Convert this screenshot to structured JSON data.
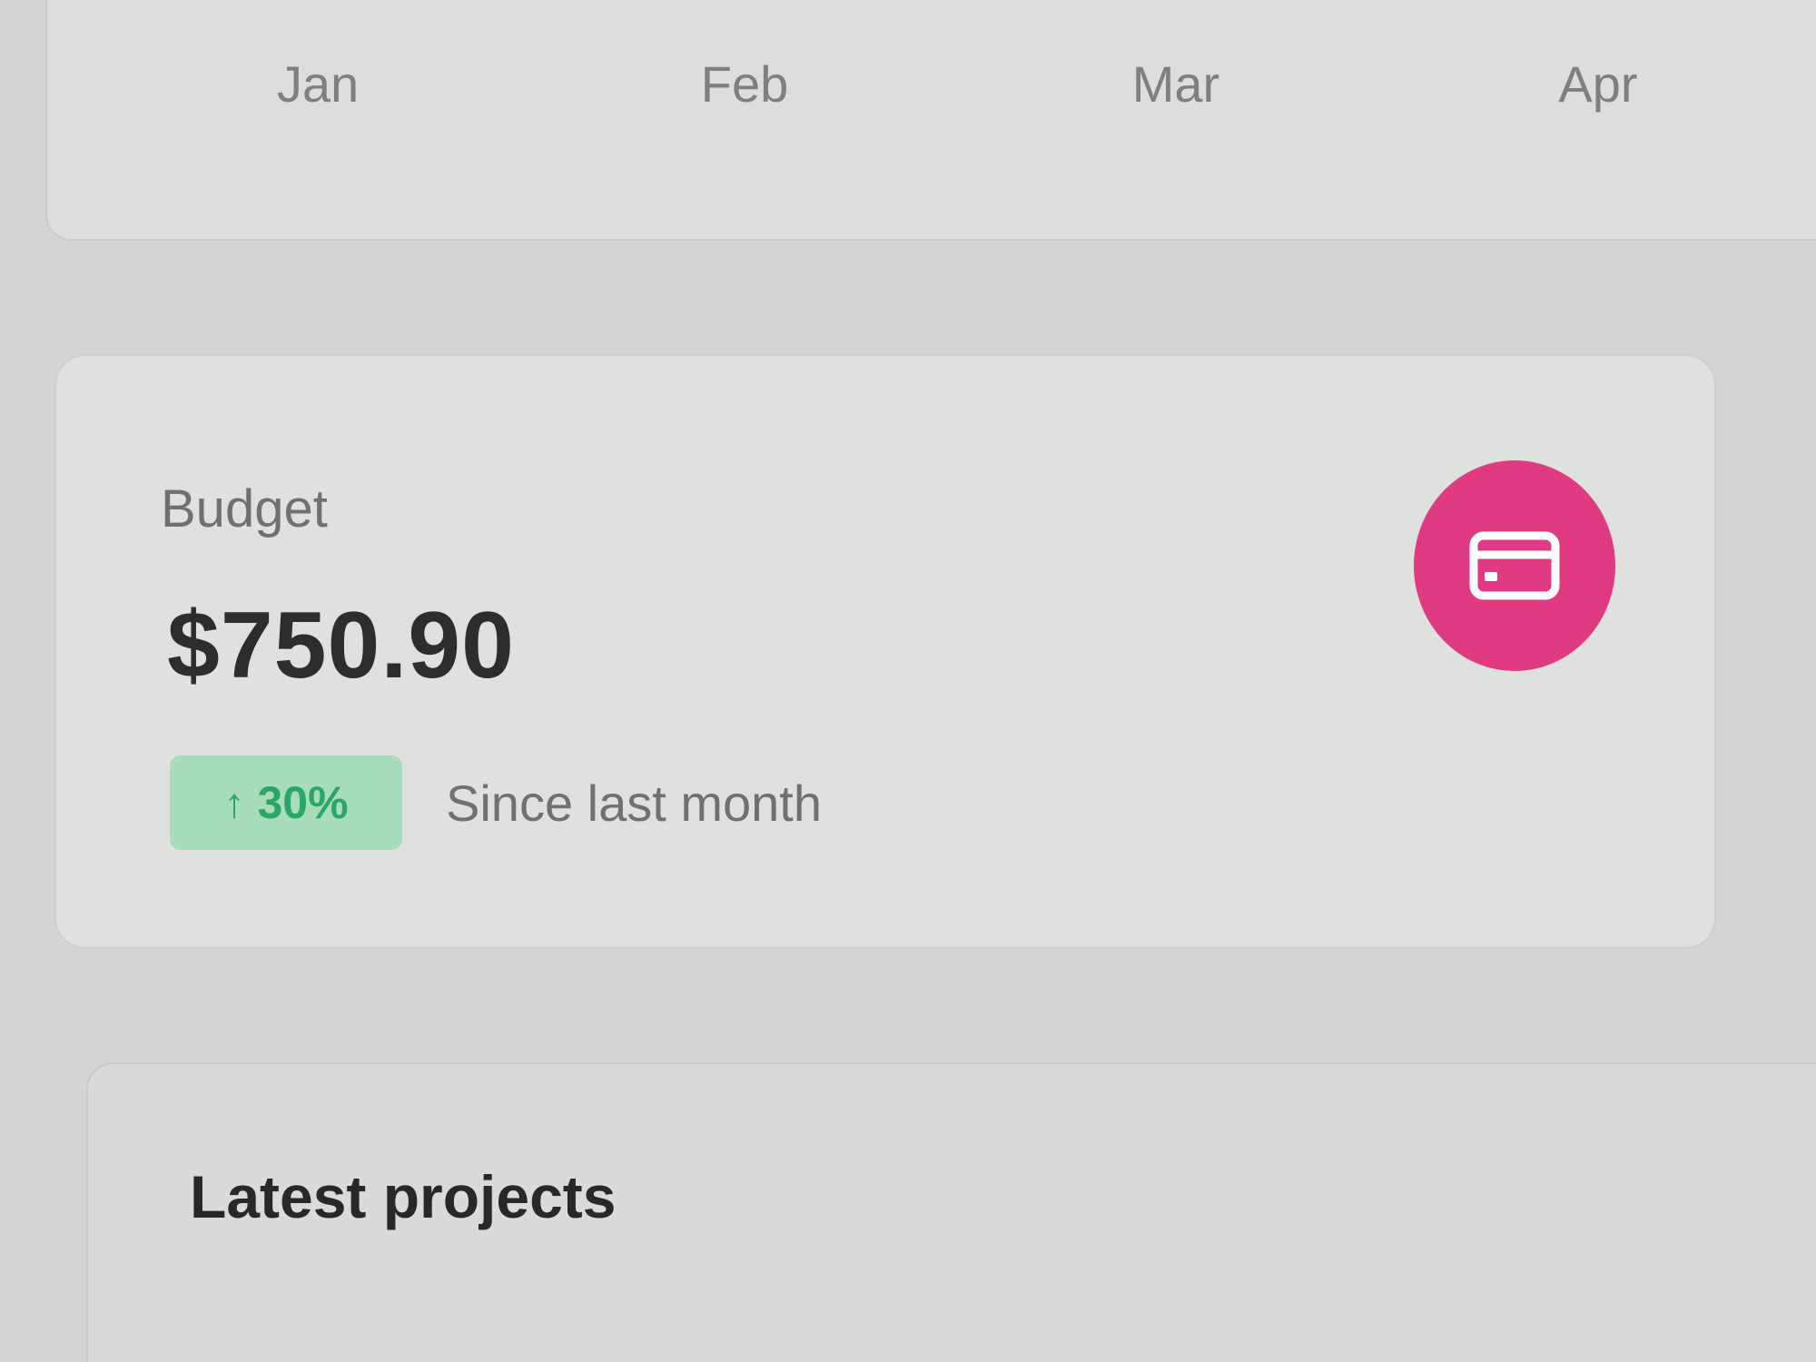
{
  "chart": {
    "months": [
      "Jan",
      "Feb",
      "Mar",
      "Apr"
    ]
  },
  "budget": {
    "title": "Budget",
    "value": "$750.90",
    "change": {
      "arrow": "↑",
      "percent": "30%",
      "caption": "Since last month",
      "color": "#2aa766",
      "background": "#a7dcbd"
    },
    "icon": "credit-card-icon",
    "icon_bg": "#e03b82"
  },
  "projects": {
    "title": "Latest projects"
  }
}
